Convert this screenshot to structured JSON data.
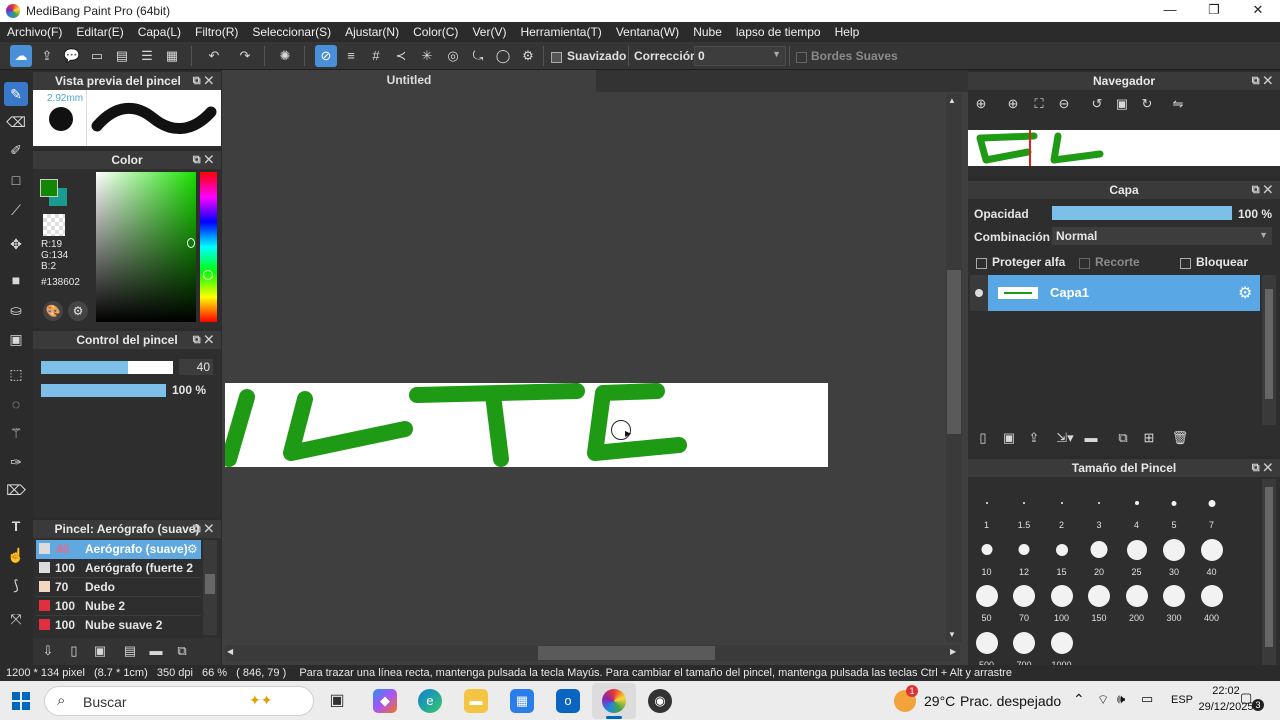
{
  "window": {
    "title": "MediBang Paint Pro (64bit)"
  },
  "menu": [
    "Archivo(F)",
    "Editar(E)",
    "Capa(L)",
    "Filtro(R)",
    "Seleccionar(S)",
    "Ajustar(N)",
    "Color(C)",
    "Ver(V)",
    "Herramienta(T)",
    "Ventana(W)",
    "Nube",
    "lapso de tiempo",
    "Help"
  ],
  "toolbar": {
    "suavizado_label": "Suavizado",
    "correccion_label": "Corrección",
    "correccion_value": "0",
    "bordes_label": "Bordes Suaves"
  },
  "brush_preview": {
    "title": "Vista previa del pincel",
    "size": "2.92mm"
  },
  "color_panel": {
    "title": "Color",
    "r": "R:19",
    "g": "G:134",
    "b": "B:2",
    "hex": "#138602",
    "fg_color": "#138602",
    "bg_color": "#1a9b8f"
  },
  "brush_control": {
    "title": "Control del pincel",
    "size_value": "40",
    "size_fraction": 0.66,
    "opacity_value": "100 %",
    "opacity_fraction": 1.0
  },
  "brush_list": {
    "title": "Pincel: Aerógrafo (suave)",
    "items": [
      {
        "size": "40",
        "name": "Aerógrafo (suave)",
        "selected": true
      },
      {
        "size": "100",
        "name": "Aerógrafo (fuerte 2"
      },
      {
        "size": "70",
        "name": "Dedo"
      },
      {
        "size": "100",
        "name": "Nube 2"
      },
      {
        "size": "100",
        "name": "Nube suave 2"
      }
    ]
  },
  "canvas": {
    "tab_title": "Untitled"
  },
  "navigator": {
    "title": "Navegador"
  },
  "layer_panel": {
    "title": "Capa",
    "opacity_label": "Opacidad",
    "opacity_value": "100 %",
    "opacity_fraction": 1.0,
    "blend_label": "Combinación",
    "blend_value": "Normal",
    "protect_alpha": "Proteger alfa",
    "clip": "Recorte",
    "lock": "Bloquear",
    "layers": [
      {
        "name": "Capa1"
      }
    ]
  },
  "brush_size_panel": {
    "title": "Tamaño del Pincel",
    "sizes": [
      "1",
      "1.5",
      "2",
      "3",
      "4",
      "5",
      "7",
      "10",
      "12",
      "15",
      "20",
      "25",
      "30",
      "40",
      "50",
      "70",
      "100",
      "150",
      "200",
      "300",
      "400",
      "500",
      "700",
      "1000"
    ]
  },
  "status": {
    "dimensions": "1200 * 134 pixel",
    "physical": "(8.7 * 1cm)",
    "dpi": "350 dpi",
    "zoom": "66 %",
    "coords": "( 846, 79 )",
    "hint": "Para trazar una línea recta, mantenga pulsada la tecla Mayús. Para cambiar el tamaño del pincel, mantenga pulsada las teclas Ctrl + Alt y arrastre"
  },
  "taskbar": {
    "search_placeholder": "Buscar",
    "weather": "29°C",
    "weather_desc": "Prac. despejado",
    "lang": "ESP",
    "time": "22:02",
    "date": "29/12/2025",
    "notif_count": "3",
    "weather_badge": "1"
  }
}
